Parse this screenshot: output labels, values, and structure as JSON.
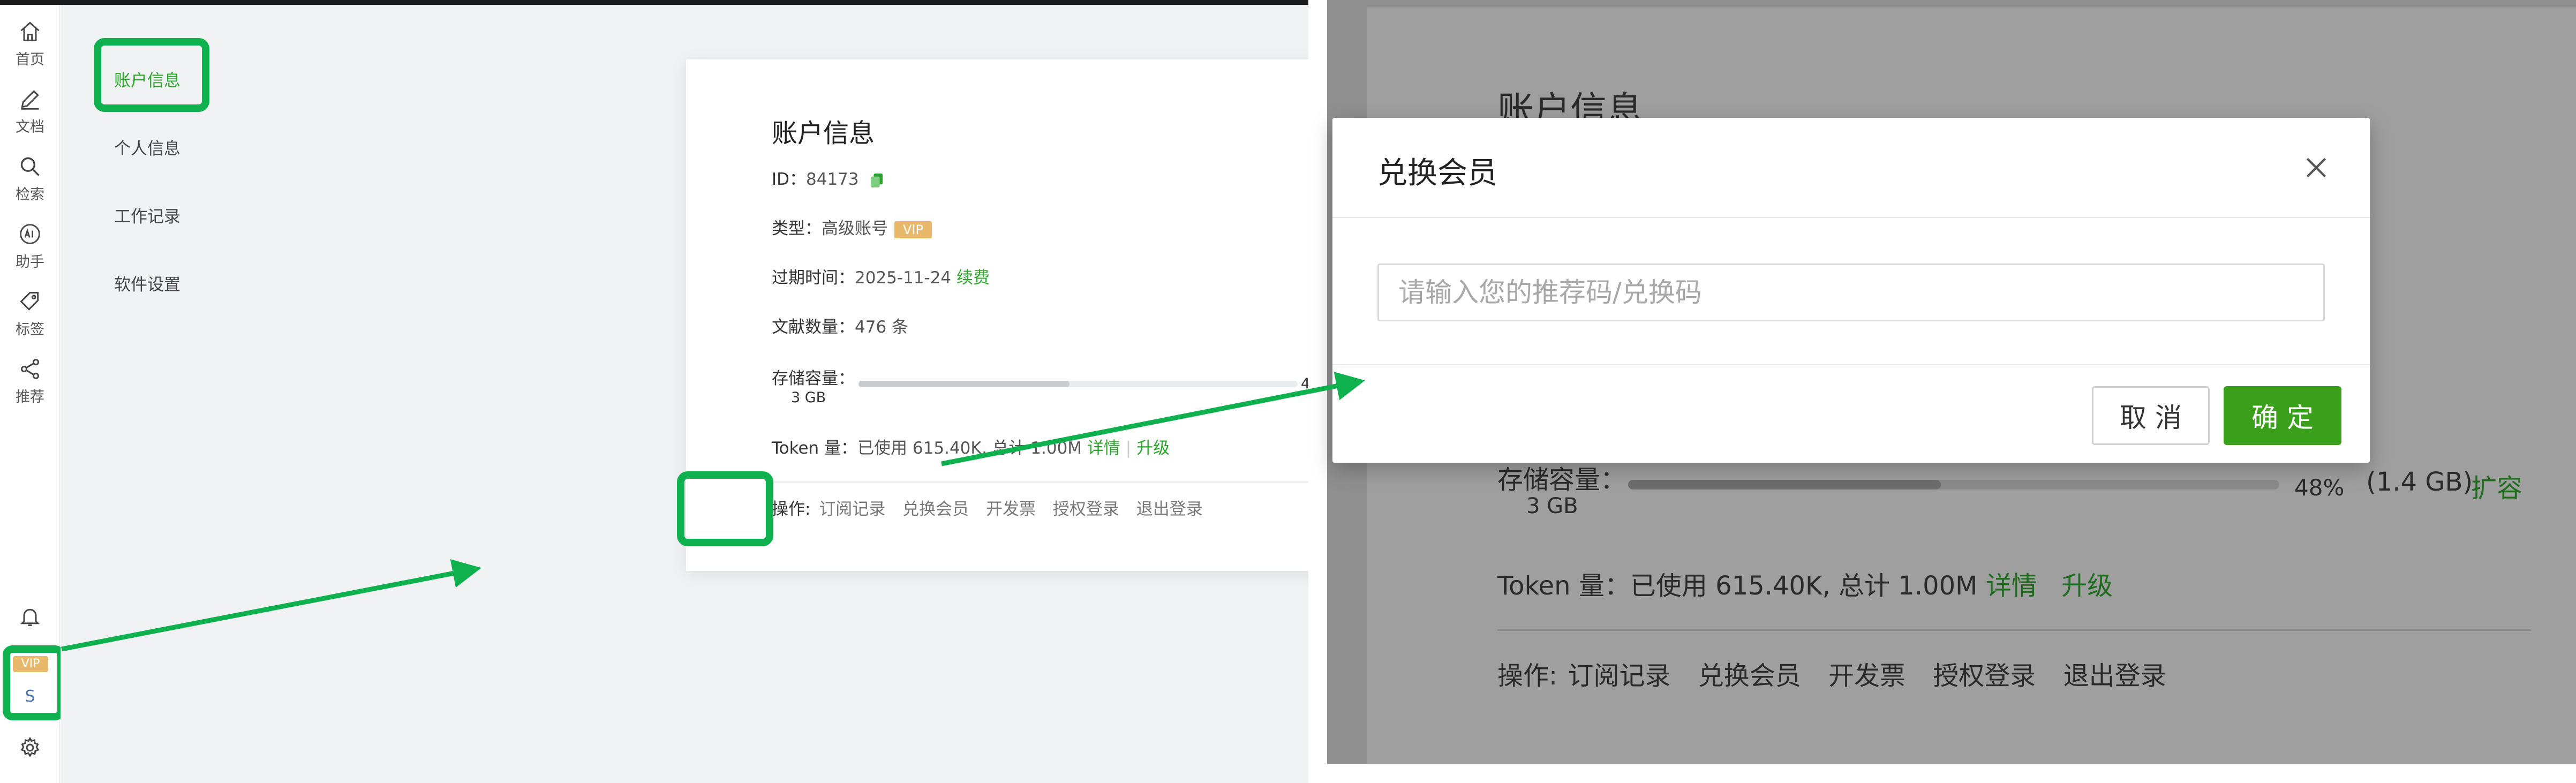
{
  "sidebar": {
    "items": [
      {
        "label": "首页",
        "icon": "home-icon"
      },
      {
        "label": "文档",
        "icon": "pen-icon"
      },
      {
        "label": "检索",
        "icon": "search-icon"
      },
      {
        "label": "助手",
        "icon": "ai-icon"
      },
      {
        "label": "标签",
        "icon": "tag-icon"
      },
      {
        "label": "推荐",
        "icon": "share-icon"
      }
    ],
    "vip_tag": "VIP",
    "avatar_letter": "S"
  },
  "menu": {
    "items": [
      "账户信息",
      "个人信息",
      "工作记录",
      "软件设置"
    ],
    "active": "账户信息"
  },
  "account": {
    "title": "账户信息",
    "id_label": "ID：",
    "id_value": "84173",
    "type_label": "类型：",
    "type_value": "高级账号",
    "type_badge": "VIP",
    "expire_label": "过期时间：",
    "expire_value": "2025-11-24",
    "renew_link": "续费",
    "docs_label": "文献数量：",
    "docs_value": "476 条",
    "storage_label": "存储容量：",
    "storage_total": "3 GB",
    "storage_percent_text": "48%",
    "storage_percent": 48,
    "storage_used": "(1.4 GB)",
    "expand_link": "扩容",
    "token_label": "Token 量：",
    "token_value": "已使用 615.40K, 总计 1.00M",
    "detail_link": "详情",
    "upgrade_link": "升级",
    "ops_label": "操作:",
    "ops": [
      "订阅记录",
      "兑换会员",
      "开发票",
      "授权登录",
      "退出登录"
    ]
  },
  "modal": {
    "title": "兑换会员",
    "input_placeholder": "请输入您的推荐码/兑换码",
    "cancel_label": "取 消",
    "ok_label": "确 定"
  },
  "background": {
    "title": "账户信息"
  },
  "colors": {
    "highlight": "#0fb14f",
    "link_green": "#2aa52a",
    "ok_button": "#3a9f1b",
    "vip_gold": "#e8b86b"
  }
}
